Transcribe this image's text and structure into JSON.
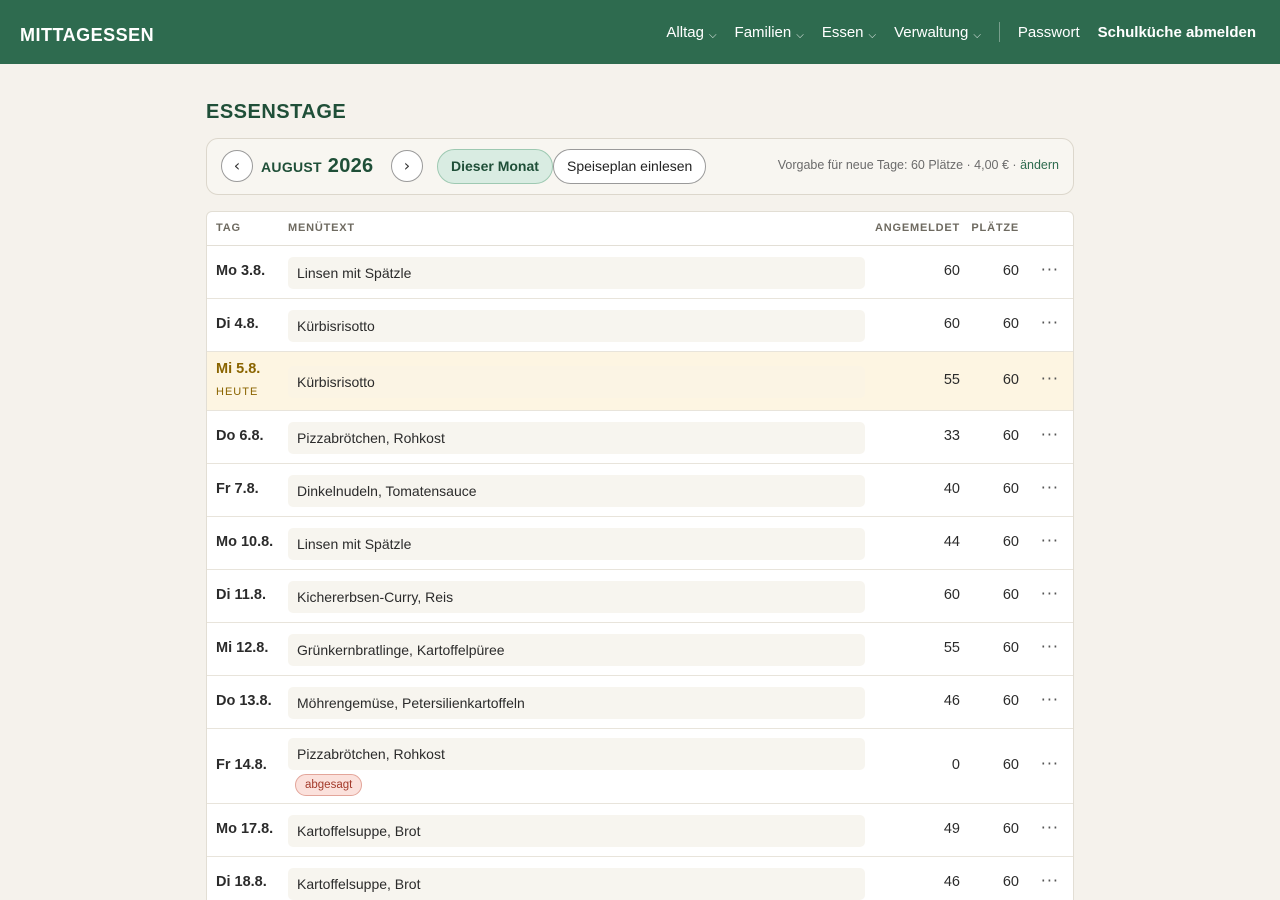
{
  "app": {
    "brand": "Mittagessen"
  },
  "nav": {
    "items": [
      {
        "label": "Alltag",
        "dropdown": true
      },
      {
        "label": "Familien",
        "dropdown": true
      },
      {
        "label": "Essen",
        "dropdown": true
      },
      {
        "label": "Verwaltung",
        "dropdown": true
      }
    ],
    "password": "Passwort",
    "logout": "Schulküche abmelden"
  },
  "page": {
    "title": "Essenstage"
  },
  "month": {
    "prev": "‹",
    "next": "›",
    "label": "August 2026",
    "current_button": "Dieser Monat",
    "import_button": "Speiseplan einlesen",
    "defaults_text": "Vorgabe für neue Tage: 60 Plätze · 4,00 € · ",
    "defaults_link": "ändern"
  },
  "table": {
    "headers": {
      "tag": "TAG",
      "menu": "MENÜTEXT",
      "angemeldet": "ANGEMELDET",
      "plaetze": "PLÄTZE"
    },
    "today_label": "HEUTE",
    "cancel_label": "abgesagt",
    "more": "···",
    "rows": [
      {
        "day": "Mo 3.8.",
        "menu": "Linsen mit Spätzle",
        "angemeldet": "60",
        "plaetze": "60"
      },
      {
        "day": "Di 4.8.",
        "menu": "Kürbisrisotto",
        "angemeldet": "60",
        "plaetze": "60"
      },
      {
        "day": "Mi 5.8.",
        "menu": "Kürbisrisotto",
        "angemeldet": "55",
        "plaetze": "60",
        "today": true
      },
      {
        "day": "Do 6.8.",
        "menu": "Pizzabrötchen, Rohkost",
        "angemeldet": "33",
        "plaetze": "60"
      },
      {
        "day": "Fr 7.8.",
        "menu": "Dinkelnudeln, Tomatensauce",
        "angemeldet": "40",
        "plaetze": "60"
      },
      {
        "day": "Mo 10.8.",
        "menu": "Linsen mit Spätzle",
        "angemeldet": "44",
        "plaetze": "60"
      },
      {
        "day": "Di 11.8.",
        "menu": "Kichererbsen-Curry, Reis",
        "angemeldet": "60",
        "plaetze": "60"
      },
      {
        "day": "Mi 12.8.",
        "menu": "Grünkernbratlinge, Kartoffelpüree",
        "angemeldet": "55",
        "plaetze": "60"
      },
      {
        "day": "Do 13.8.",
        "menu": "Möhrengemüse, Petersilienkartoffeln",
        "angemeldet": "46",
        "plaetze": "60"
      },
      {
        "day": "Fr 14.8.",
        "menu": "Pizzabrötchen, Rohkost",
        "angemeldet": "0",
        "plaetze": "60",
        "cancelled": true
      },
      {
        "day": "Mo 17.8.",
        "menu": "Kartoffelsuppe, Brot",
        "angemeldet": "49",
        "plaetze": "60"
      },
      {
        "day": "Di 18.8.",
        "menu": "Kartoffelsuppe, Brot",
        "angemeldet": "46",
        "plaetze": "60"
      }
    ]
  },
  "colors": {
    "topbar": "#2e6b4f",
    "accent": "#1f4f38",
    "today_bg": "#fdf5e2",
    "cancel_badge": "#fbe1dc"
  }
}
